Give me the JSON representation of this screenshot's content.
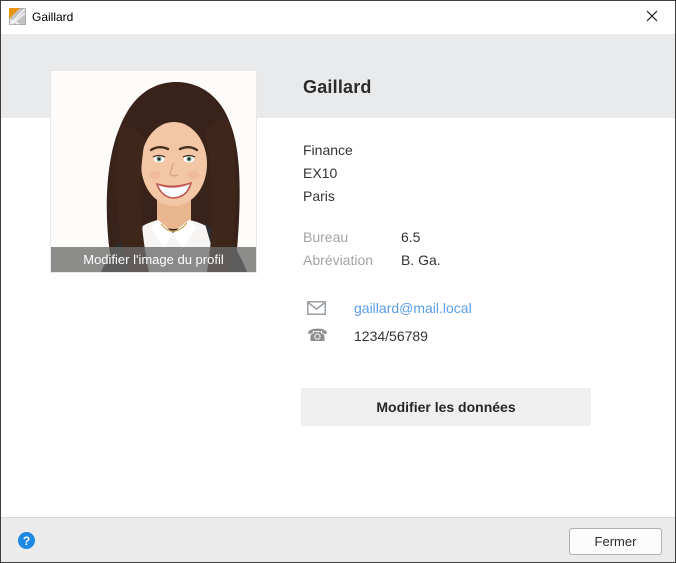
{
  "window": {
    "title": "Gaillard"
  },
  "profile": {
    "name": "Gaillard",
    "photo_overlay": "Modifier l'image du profil",
    "org_lines": [
      "Finance",
      "EX10",
      "Paris"
    ],
    "fields": [
      {
        "label": "Bureau",
        "value": "6.5"
      },
      {
        "label": "Abréviation",
        "value": "B. Ga."
      }
    ],
    "email": "gaillard@mail.local",
    "phone": "1234/56789",
    "edit_button_label": "Modifier les données"
  },
  "footer": {
    "help_label": "?",
    "close_button_label": "Fermer"
  },
  "icons": {
    "phone_glyph": "☎"
  },
  "colors": {
    "email_link_blue": "#5b9de8",
    "help_icon_blue": "#1e88e5",
    "header_band_gray": "#e9eaeb",
    "footer_gray": "#ebebec"
  }
}
